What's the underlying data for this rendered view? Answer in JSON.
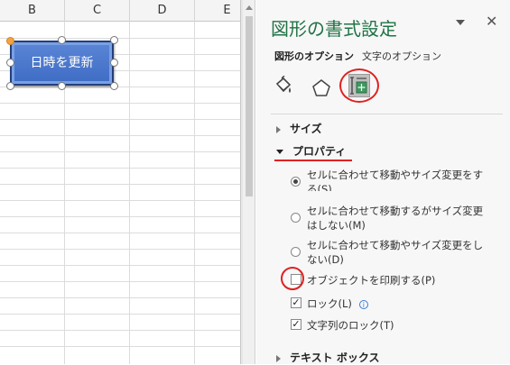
{
  "sheet": {
    "columns": [
      "B",
      "C",
      "D",
      "E"
    ],
    "shape_label": "日時を更新"
  },
  "pane": {
    "title": "図形の書式設定",
    "tabs": [
      {
        "label": "図形のオプション",
        "active": true
      },
      {
        "label": "文字のオプション",
        "active": false
      }
    ],
    "icons": [
      "fill-line-icon",
      "effects-pentagon-icon",
      "size-properties-icon"
    ],
    "sections": {
      "size": "サイズ",
      "properties": "プロパティ",
      "textbox": "テキスト ボックス"
    },
    "radios": [
      {
        "label": "セルに合わせて移動やサイズ変更をする(S)",
        "selected": true
      },
      {
        "label": "セルに合わせて移動するがサイズ変更はしない(M)",
        "selected": false
      },
      {
        "label": "セルに合わせて移動やサイズ変更をしない(D)",
        "selected": false
      }
    ],
    "checkboxes": [
      {
        "label": "オブジェクトを印刷する(P)",
        "checked": false
      },
      {
        "label": "ロック(L)",
        "checked": true
      },
      {
        "label": "文字列のロック(T)",
        "checked": true
      }
    ],
    "close_symbol": "✕",
    "info_symbol": "i",
    "check_symbol": "✓",
    "accent_color": "#217346",
    "highlight_color": "#e02020"
  }
}
